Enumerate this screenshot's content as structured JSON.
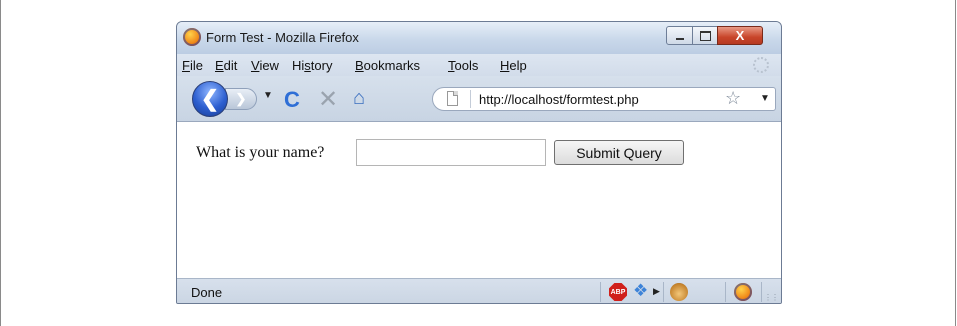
{
  "window": {
    "title": "Form Test - Mozilla Firefox",
    "controls": {
      "minimize": "minimize",
      "maximize": "maximize",
      "close_label": "X"
    }
  },
  "menubar": {
    "items": [
      {
        "label_accel": "F",
        "label_rest": "ile"
      },
      {
        "label_accel": "E",
        "label_rest": "dit"
      },
      {
        "label_accel": "V",
        "label_rest": "iew"
      },
      {
        "label_pre": "Hi",
        "label_accel": "s",
        "label_rest": "tory"
      },
      {
        "label_accel": "B",
        "label_rest": "ookmarks"
      },
      {
        "label_accel": "T",
        "label_rest": "ools"
      },
      {
        "label_accel": "H",
        "label_rest": "elp"
      }
    ]
  },
  "navbar": {
    "url": "http://localhost/formtest.php"
  },
  "content": {
    "label": "What is your name?",
    "input_value": "",
    "submit_label": "Submit Query"
  },
  "statusbar": {
    "status_text": "Done",
    "adblock_label": "ABP"
  },
  "icons": {
    "back": "back-arrow-icon",
    "forward": "forward-arrow-icon",
    "reload": "reload-icon",
    "stop": "stop-icon",
    "home": "home-icon",
    "star": "star-icon"
  }
}
